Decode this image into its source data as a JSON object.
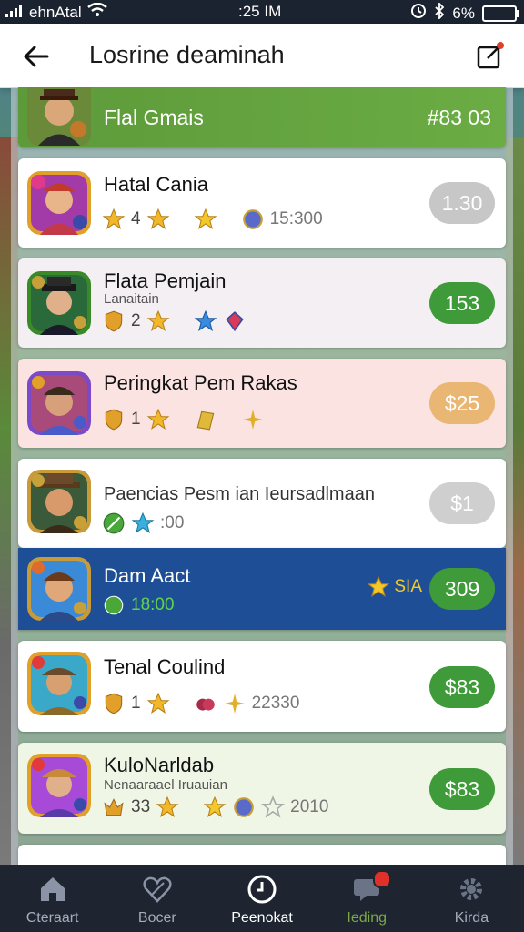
{
  "status_bar": {
    "carrier": "ehnAtal",
    "time": ":25 IM",
    "battery": "6%"
  },
  "header": {
    "title": "Losrine deaminah"
  },
  "top_row": {
    "name": "Flal Gmais",
    "value": "#83 03"
  },
  "rows": [
    {
      "name": "Hatal Cania",
      "sub": "",
      "stats": [
        "4",
        "",
        "15:300"
      ],
      "pill": "1.30",
      "pill_color": "#c7c7c7",
      "bg": "#ffffff"
    },
    {
      "name": "Flata Pemjain",
      "sub": "Lanaitain",
      "stats": [
        "2",
        "",
        ""
      ],
      "pill": "153",
      "pill_color": "#3f9a3a",
      "bg": "#f4eff2"
    },
    {
      "name": "Peringkat Pem Rakas",
      "sub": "",
      "stats": [
        "1",
        "",
        ""
      ],
      "pill": "$25",
      "pill_color": "#e9b673",
      "bg": "#fbe3e2"
    },
    {
      "name": "Paencias Pesm ian Ieursadlmaan",
      "sub": "",
      "stats": [
        "",
        ":00",
        ""
      ],
      "pill": "$1",
      "pill_color": "#cfcfcf",
      "bg": "#ffffff"
    },
    {
      "name": "Dam Aact",
      "sub": "",
      "stats": [
        "18:00",
        "SIA",
        ""
      ],
      "pill": "309",
      "pill_color": "#3f9a3a",
      "bg": "#1e4f96"
    },
    {
      "name": "Tenal Coulind",
      "sub": "",
      "stats": [
        "1",
        "",
        "22330"
      ],
      "pill": "$83",
      "pill_color": "#3f9a3a",
      "bg": "#ffffff"
    },
    {
      "name": "KuloNarldab",
      "sub": "Nenaaraael Iruauian",
      "stats": [
        "33",
        "",
        "2010"
      ],
      "pill": "$83",
      "pill_color": "#3f9a3a",
      "bg": "#f0f6e6"
    }
  ],
  "bottom_nav": [
    {
      "label": "Cteraart",
      "icon": "home-icon"
    },
    {
      "label": "Bocer",
      "icon": "heart-icon"
    },
    {
      "label": "Peenokat",
      "icon": "clock-icon"
    },
    {
      "label": "Ieding",
      "icon": "chat-icon"
    },
    {
      "label": "Kirda",
      "icon": "gear-icon"
    }
  ],
  "colors": {
    "green": "#3f9a3a",
    "blue_row": "#1e4f96",
    "header_green": "#5d9a3a",
    "nav_bg": "#1e2530"
  }
}
